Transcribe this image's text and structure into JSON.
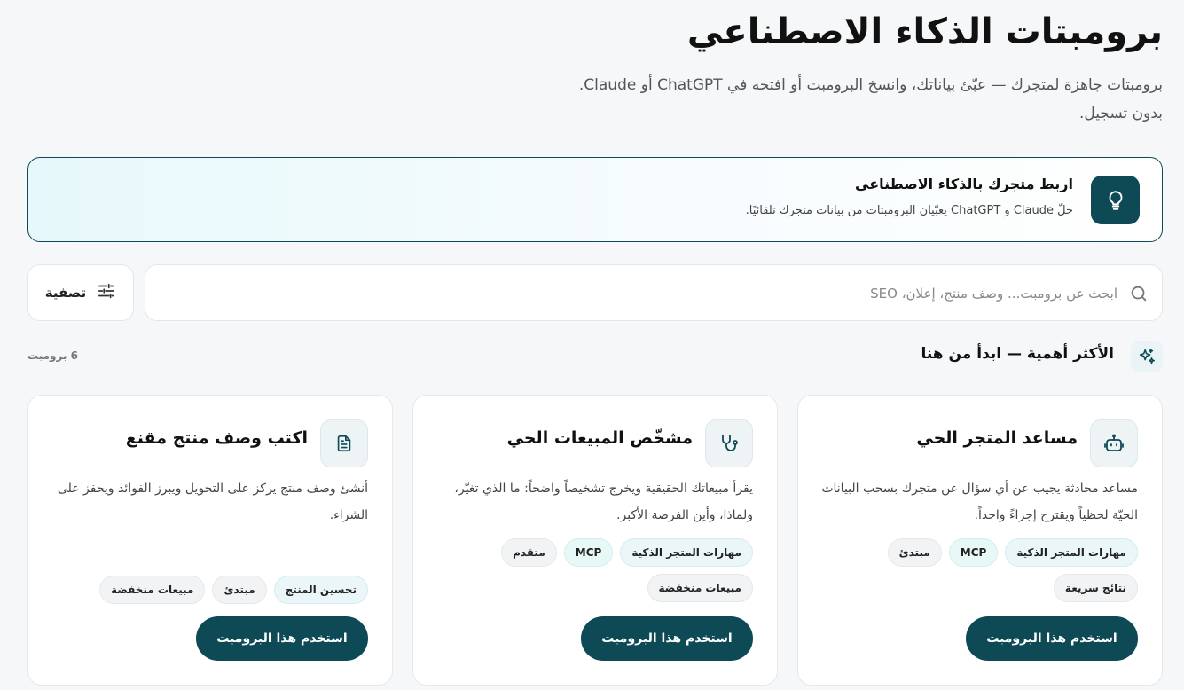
{
  "header": {
    "title": "برومبتات الذكاء الاصطناعي",
    "subtitle": "برومبتات جاهزة لمتجرك — عبّئ بياناتك، وانسخ البرومبت أو افتحه في ChatGPT أو Claude. بدون تسجيل."
  },
  "banner": {
    "icon": "lightbulb-icon",
    "title": "اربط متجرك بالذكاء الاصطناعي",
    "description": "خلّ Claude و ChatGPT يعبّيان البرومبتات من بيانات متجرك تلقائيًا."
  },
  "search": {
    "placeholder": "ابحث عن برومبت... وصف منتج، إعلان، SEO",
    "value": ""
  },
  "filter": {
    "label": "تصفية"
  },
  "section": {
    "title": "الأكثر أهمية — ابدأ من هنا",
    "count": "6 برومبت"
  },
  "cards": [
    {
      "icon": "robot-icon",
      "title": "مساعد المتجر الحي",
      "description": "مساعد محادثة يجيب عن أي سؤال عن متجرك بسحب البيانات الحيّة لحظياً ويقترح إجراءً واحداً.",
      "tags": [
        "مهارات المتجر الذكية",
        "MCP",
        "مبتدئ",
        "نتائج سريعة"
      ],
      "button": "استخدم هذا البرومبت"
    },
    {
      "icon": "stethoscope-icon",
      "title": "مشخّص المبيعات الحي",
      "description": "يقرأ مبيعاتك الحقيقية ويخرج تشخيصاً واضحاً: ما الذي تغيّر، ولماذا، وأين الفرصة الأكبر.",
      "tags": [
        "مهارات المتجر الذكية",
        "MCP",
        "متقدم",
        "مبيعات منخفضة"
      ],
      "button": "استخدم هذا البرومبت"
    },
    {
      "icon": "document-icon",
      "title": "اكتب وصف منتج مقنع",
      "description": "أنشئ وصف منتج يركز على التحويل ويبرز الفوائد ويحفز على الشراء.",
      "tags": [
        "تحسين المنتج",
        "مبتدئ",
        "مبيعات منخفضة"
      ],
      "button": "استخدم هذا البرومبت"
    }
  ],
  "colors": {
    "accent": "#0d4a55",
    "background": "#f6f7f8"
  }
}
